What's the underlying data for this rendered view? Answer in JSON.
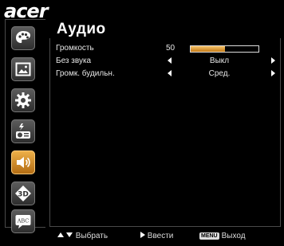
{
  "brand": {
    "logo_text": "acer"
  },
  "sidebar": {
    "items": [
      {
        "icon": "palette-icon",
        "active": false
      },
      {
        "icon": "image-icon",
        "active": false
      },
      {
        "icon": "gear-icon",
        "active": false
      },
      {
        "icon": "projector-management-icon",
        "active": false
      },
      {
        "icon": "speaker-icon",
        "active": true
      },
      {
        "icon": "3d-icon",
        "active": false
      },
      {
        "icon": "language-abc-icon",
        "active": false
      }
    ]
  },
  "page": {
    "title": "Аудио"
  },
  "settings": [
    {
      "label": "Громкость",
      "number": "50",
      "level_fraction": 0.5
    },
    {
      "label": "Без звука",
      "value": "Выкл"
    },
    {
      "label": "Громк. будильн.",
      "value": "Сред."
    }
  ],
  "footer": {
    "select_label": "Выбрать",
    "enter_label": "Ввести",
    "menu_key": "MENU",
    "exit_label": "Выход"
  },
  "colors": {
    "accent": "#e09a30",
    "frame": "#4a4a4a"
  }
}
